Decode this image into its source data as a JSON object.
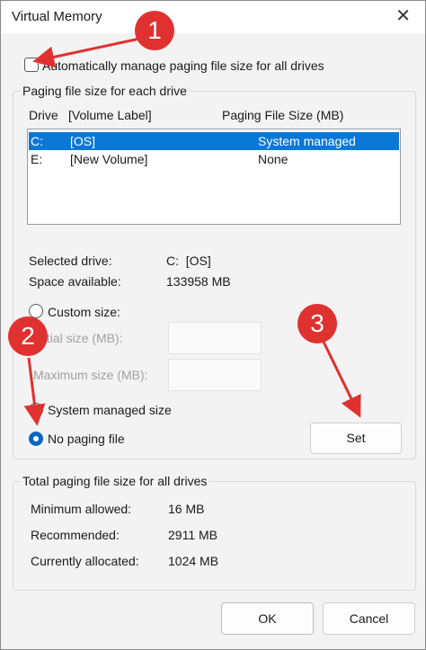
{
  "window": {
    "title": "Virtual Memory",
    "close_glyph": "✕"
  },
  "auto_manage": {
    "label": "Automatically manage paging file size for all drives",
    "checked": false
  },
  "drives_group": {
    "title": "Paging file size for each drive",
    "col_drive": "Drive",
    "col_label": "[Volume Label]",
    "col_size": "Paging File Size (MB)",
    "rows": [
      {
        "drive": "C:",
        "label": "[OS]",
        "size": "System managed",
        "selected": true
      },
      {
        "drive": "E:",
        "label": "[New Volume]",
        "size": "None",
        "selected": false
      }
    ],
    "selected_drive_label": "Selected drive:",
    "selected_drive_value": "C:  [OS]",
    "space_label": "Space available:",
    "space_value": "133958 MB",
    "custom_size": "Custom size:",
    "initial_size": "Initial size (MB):",
    "max_size": "Maximum size (MB):",
    "system_managed": "System managed size",
    "no_paging": "No paging file",
    "set_button": "Set"
  },
  "totals_group": {
    "title": "Total paging file size for all drives",
    "min_label": "Minimum allowed:",
    "min_value": "16 MB",
    "rec_label": "Recommended:",
    "rec_value": "2911 MB",
    "cur_label": "Currently allocated:",
    "cur_value": "1024 MB"
  },
  "buttons": {
    "ok": "OK",
    "cancel": "Cancel"
  },
  "annotations": {
    "step1": "1",
    "step2": "2",
    "step3": "3",
    "color": "#e03131"
  },
  "colors": {
    "selection": "#0a78d7",
    "radio_accent": "#0a66c2"
  }
}
